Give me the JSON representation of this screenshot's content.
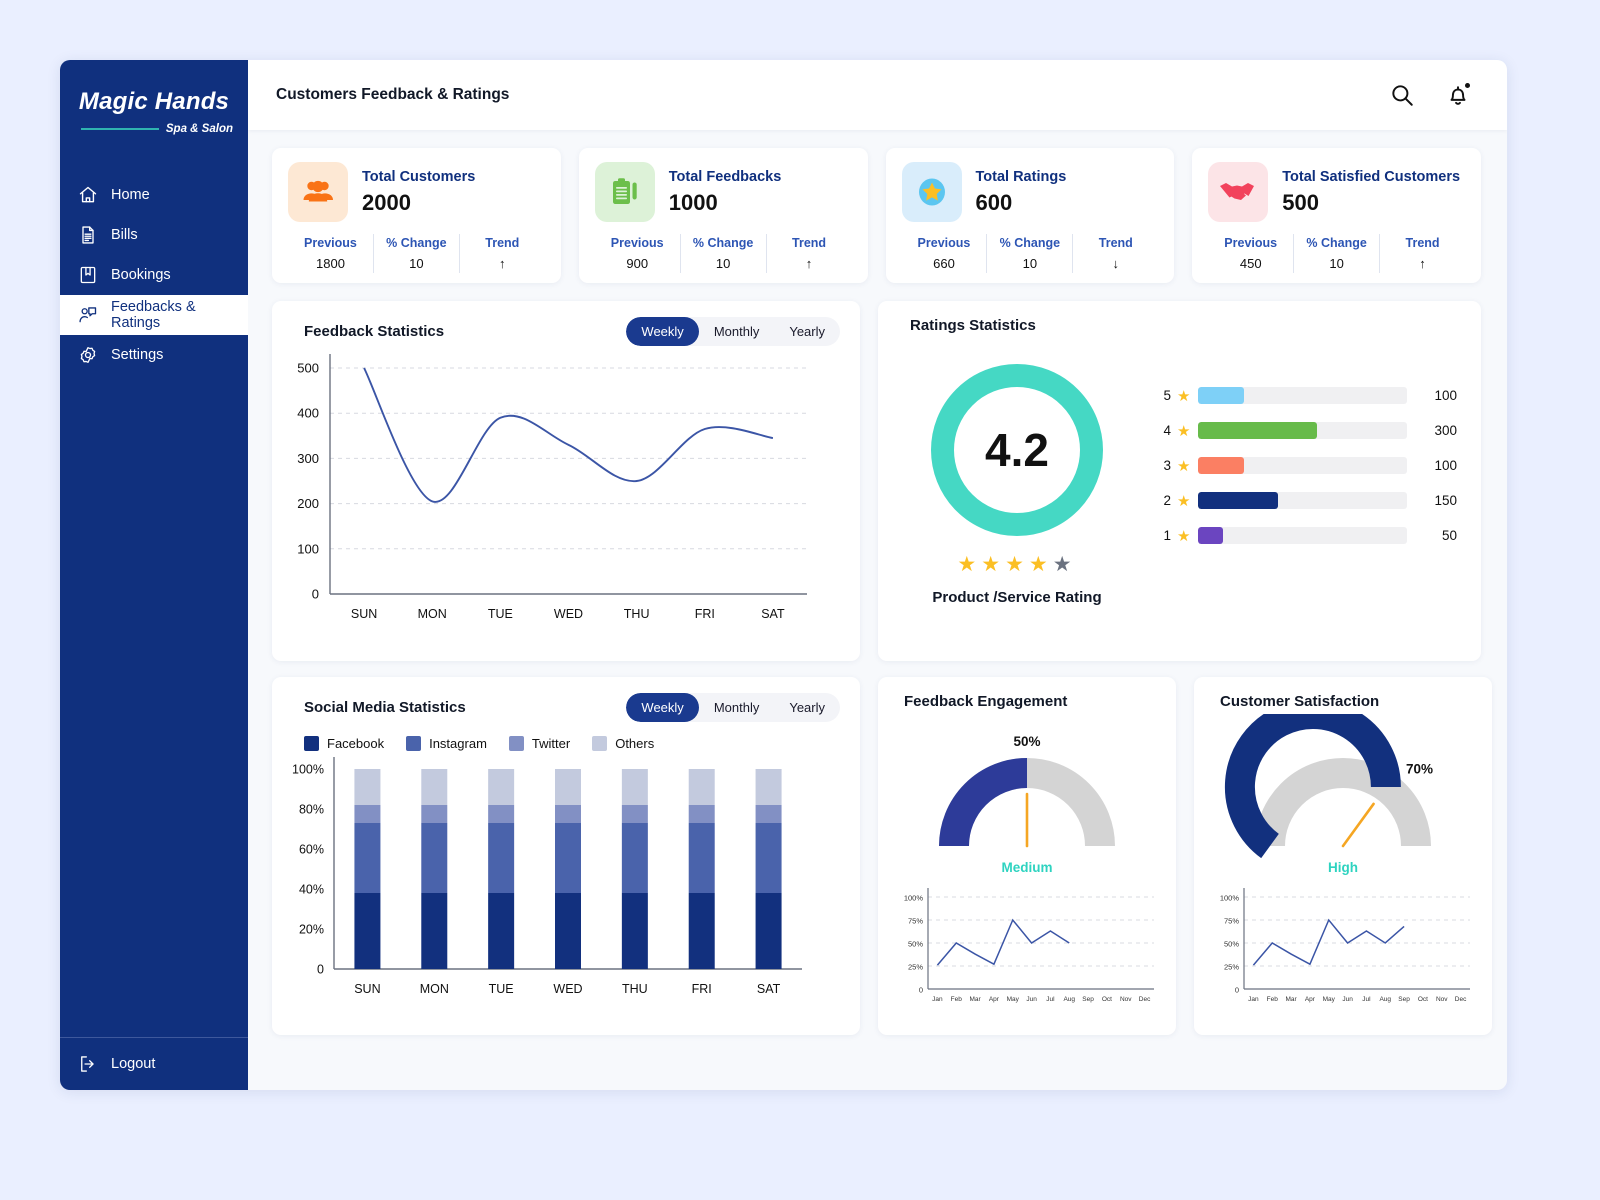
{
  "brand": {
    "name": "Magic Hands",
    "sub": "Spa & Salon"
  },
  "sidebar": {
    "items": [
      {
        "label": "Home",
        "icon": "home-icon"
      },
      {
        "label": "Bills",
        "icon": "bill-icon"
      },
      {
        "label": "Bookings",
        "icon": "bookmark-icon"
      },
      {
        "label": "Feedbacks & Ratings",
        "icon": "feedback-icon"
      },
      {
        "label": "Settings",
        "icon": "gear-icon"
      }
    ],
    "active_index": 3,
    "logout": "Logout"
  },
  "topbar": {
    "title": "Customers Feedback & Ratings",
    "search_icon": "search-icon",
    "bell_icon": "bell-icon"
  },
  "kpis": [
    {
      "label": "Total Customers",
      "value": "2000",
      "icon": "users-icon",
      "icon_bg": "#fde8d4",
      "icon_color": "#f97316",
      "foot": [
        {
          "head": "Previous",
          "val": "1800"
        },
        {
          "head": "% Change",
          "val": "10"
        },
        {
          "head": "Trend",
          "val": "↑"
        }
      ]
    },
    {
      "label": "Total Feedbacks",
      "value": "1000",
      "icon": "clipboard-icon",
      "icon_bg": "#ddf2d8",
      "icon_color": "#6cbf4b",
      "foot": [
        {
          "head": "Previous",
          "val": "900"
        },
        {
          "head": "% Change",
          "val": "10"
        },
        {
          "head": "Trend",
          "val": "↑"
        }
      ]
    },
    {
      "label": "Total Ratings",
      "value": "600",
      "icon": "star-badge-icon",
      "icon_bg": "#d9edfb",
      "icon_color": "#5bc6f0",
      "foot": [
        {
          "head": "Previous",
          "val": "660"
        },
        {
          "head": "% Change",
          "val": "10"
        },
        {
          "head": "Trend",
          "val": "↓"
        }
      ]
    },
    {
      "label": "Total Satisfied Customers",
      "value": "500",
      "icon": "handshake-icon",
      "icon_bg": "#fce4e7",
      "icon_color": "#f2425c",
      "foot": [
        {
          "head": "Previous",
          "val": "450"
        },
        {
          "head": "% Change",
          "val": "10"
        },
        {
          "head": "Trend",
          "val": "↑"
        }
      ]
    }
  ],
  "feedback_panel": {
    "title": "Feedback  Statistics",
    "toggle": {
      "options": [
        "Weekly",
        "Monthly",
        "Yearly"
      ],
      "selected": "Weekly"
    }
  },
  "social_panel": {
    "title": "Social Media Statistics",
    "toggle": {
      "options": [
        "Weekly",
        "Monthly",
        "Yearly"
      ],
      "selected": "Weekly"
    },
    "legend": [
      {
        "label": "Facebook",
        "color": "#12307e"
      },
      {
        "label": "Instagram",
        "color": "#4a63ab"
      },
      {
        "label": "Twitter",
        "color": "#8290c4"
      },
      {
        "label": "Others",
        "color": "#c3cade"
      }
    ]
  },
  "ratings_panel": {
    "title": "Ratings Statistics",
    "score": "4.2",
    "ring_color": "#45d8c4",
    "stars_filled": 4,
    "stars_total": 5,
    "caption": "Product /Service Rating",
    "rows": [
      {
        "stars": "5",
        "value": "100",
        "color": "#7ed0f7",
        "pct": 22
      },
      {
        "stars": "4",
        "value": "300",
        "color": "#67bb4a",
        "pct": 57
      },
      {
        "stars": "3",
        "value": "100",
        "color": "#fb7f63",
        "pct": 22
      },
      {
        "stars": "2",
        "value": "150",
        "color": "#12307e",
        "pct": 38
      },
      {
        "stars": "1",
        "value": "50",
        "color": "#6b45c0",
        "pct": 12
      }
    ]
  },
  "gauges": [
    {
      "title": "Feedback Engagement",
      "pct_label": "50%",
      "level": "Medium",
      "value": 50,
      "arc_color": "#2d3b99",
      "track_color": "#d4d4d4",
      "needle_color": "#f5a623",
      "level_color": "#2ed3c0"
    },
    {
      "title": "Customer Satisfaction",
      "pct_label": "70%",
      "level": "High",
      "value": 70,
      "arc_color": "#12307e",
      "track_color": "#d4d4d4",
      "needle_color": "#f5a623",
      "level_color": "#2ed3c0"
    }
  ],
  "chart_data": [
    {
      "id": "feedback-statistics",
      "type": "line",
      "title": "Feedback  Statistics",
      "categories": [
        "SUN",
        "MON",
        "TUE",
        "WED",
        "THU",
        "FRI",
        "SAT"
      ],
      "values": [
        500,
        205,
        390,
        330,
        250,
        365,
        345
      ],
      "series": [
        {
          "name": "Feedbacks",
          "values": [
            500,
            205,
            390,
            330,
            250,
            365,
            345
          ],
          "color": "#3b55a6"
        }
      ],
      "xlabel": "",
      "ylabel": "",
      "ylim": [
        0,
        500
      ],
      "yticks": [
        0,
        100,
        200,
        300,
        400,
        500
      ],
      "grid": true,
      "legend": "none",
      "smoothing": "spline"
    },
    {
      "id": "social-media-statistics",
      "type": "bar",
      "subtype": "stacked-100",
      "title": "Social Media Statistics",
      "categories": [
        "SUN",
        "MON",
        "TUE",
        "WED",
        "THU",
        "FRI",
        "SAT"
      ],
      "series": [
        {
          "name": "Facebook",
          "color": "#12307e",
          "values": [
            38,
            38,
            38,
            38,
            38,
            38,
            38
          ]
        },
        {
          "name": "Instagram",
          "color": "#4a63ab",
          "values": [
            35,
            35,
            35,
            35,
            35,
            35,
            35
          ]
        },
        {
          "name": "Twitter",
          "color": "#8290c4",
          "values": [
            9,
            9,
            9,
            9,
            9,
            9,
            9
          ]
        },
        {
          "name": "Others",
          "color": "#c3cade",
          "values": [
            18,
            18,
            18,
            18,
            18,
            18,
            18
          ]
        }
      ],
      "ylim": [
        0,
        100
      ],
      "yticks": [
        "0",
        "20%",
        "40%",
        "60%",
        "80%",
        "100%"
      ],
      "grid": false,
      "legend": "top-left"
    },
    {
      "id": "ratings-distribution",
      "type": "bar",
      "subtype": "horizontal",
      "title": "Ratings Statistics",
      "categories": [
        "5",
        "4",
        "3",
        "2",
        "1"
      ],
      "values": [
        100,
        300,
        100,
        150,
        50
      ],
      "colors": [
        "#7ed0f7",
        "#67bb4a",
        "#fb7f63",
        "#12307e",
        "#6b45c0"
      ],
      "grid": false,
      "legend": "none"
    },
    {
      "id": "feedback-engagement-gauge",
      "type": "gauge",
      "title": "Feedback Engagement",
      "value": 50,
      "label": "50%",
      "level": "Medium",
      "range": [
        0,
        100
      ]
    },
    {
      "id": "feedback-engagement-trend",
      "type": "line",
      "title": "",
      "categories": [
        "Jan",
        "Feb",
        "Mar",
        "Apr",
        "May",
        "Jun",
        "Jul",
        "Aug",
        "Sep",
        "Oct",
        "Nov",
        "Dec"
      ],
      "values": [
        26,
        50,
        38,
        27,
        75,
        50,
        63,
        50,
        null,
        null,
        null,
        null
      ],
      "ylim": [
        0,
        100
      ],
      "yticks": [
        "0",
        "25%",
        "50%",
        "75%",
        "100%"
      ],
      "grid": true,
      "legend": "none"
    },
    {
      "id": "customer-satisfaction-gauge",
      "type": "gauge",
      "title": "Customer Satisfaction",
      "value": 70,
      "label": "70%",
      "level": "High",
      "range": [
        0,
        100
      ]
    },
    {
      "id": "customer-satisfaction-trend",
      "type": "line",
      "title": "",
      "categories": [
        "Jan",
        "Feb",
        "Mar",
        "Apr",
        "May",
        "Jun",
        "Jul",
        "Aug",
        "Sep",
        "Oct",
        "Nov",
        "Dec"
      ],
      "values": [
        26,
        50,
        38,
        27,
        75,
        50,
        63,
        50,
        68,
        null,
        null,
        null
      ],
      "ylim": [
        0,
        100
      ],
      "yticks": [
        "0",
        "25%",
        "50%",
        "75%",
        "100%"
      ],
      "grid": true,
      "legend": "none"
    }
  ]
}
